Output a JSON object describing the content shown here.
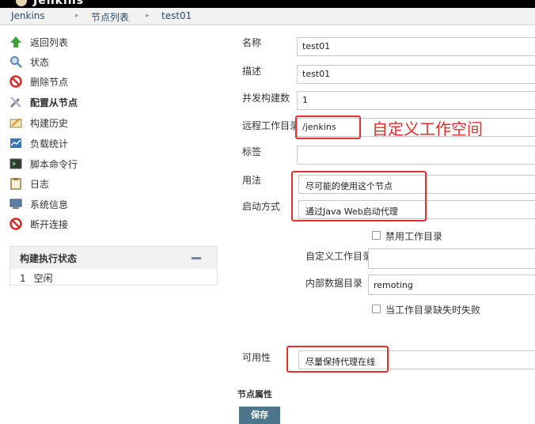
{
  "header": {
    "logo_text": "Jenkins"
  },
  "breadcrumb": {
    "items": [
      "Jenkins",
      "节点列表",
      "test01"
    ],
    "separator": "▸"
  },
  "sidebar": {
    "items": [
      {
        "label": "返回列表",
        "icon": "up-arrow-icon"
      },
      {
        "label": "状态",
        "icon": "search-icon"
      },
      {
        "label": "删除节点",
        "icon": "no-entry-icon"
      },
      {
        "label": "配置从节点",
        "icon": "wrench-icon"
      },
      {
        "label": "构建历史",
        "icon": "notepad-icon"
      },
      {
        "label": "负载统计",
        "icon": "chart-icon"
      },
      {
        "label": "脚本命令行",
        "icon": "terminal-icon"
      },
      {
        "label": "日志",
        "icon": "clipboard-icon"
      },
      {
        "label": "系统信息",
        "icon": "computer-icon"
      },
      {
        "label": "断开连接",
        "icon": "no-entry-icon"
      }
    ]
  },
  "executor_status": {
    "title": "构建执行状态",
    "rows": [
      {
        "index": "1",
        "status": "空闲"
      }
    ]
  },
  "form": {
    "name_label": "名称",
    "name_value": "test01",
    "desc_label": "描述",
    "desc_value": "test01",
    "executors_label": "并发构建数",
    "executors_value": "1",
    "remote_dir_label": "远程工作目录",
    "remote_dir_value": "/jenkins",
    "labels_label": "标签",
    "labels_value": "",
    "usage_label": "用法",
    "usage_value": "尽可能的使用这个节点",
    "launch_label": "启动方式",
    "launch_value": "通过Java Web启动代理",
    "disable_workdir_label": "禁用工作目录",
    "custom_workdir_label": "自定义工作目录",
    "custom_workdir_value": "",
    "internal_dir_label": "内部数据目录",
    "internal_dir_value": "remoting",
    "fail_if_missing_label": "当工作目录缺失时失败",
    "availability_label": "可用性",
    "availability_value": "尽量保持代理在线",
    "node_props_label": "节点属性",
    "save_label": "保存"
  },
  "annotation": {
    "text": "自定义工作空间",
    "color": "#e03030"
  }
}
